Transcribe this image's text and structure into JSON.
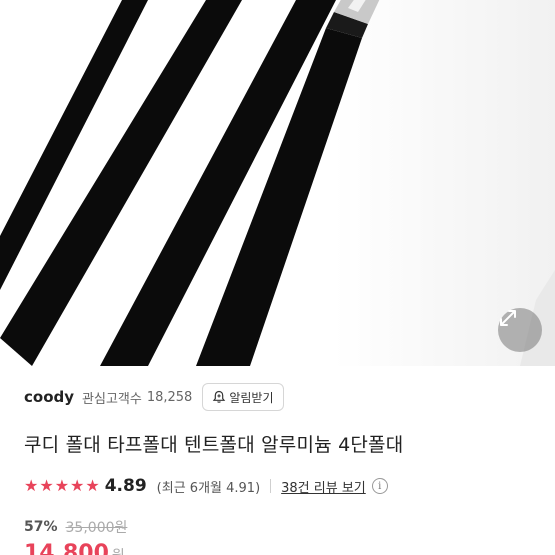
{
  "hero": {
    "image": "tent-pole-product-photo",
    "zoom_icon": "expand-arrows-icon"
  },
  "seller": {
    "name": "coody",
    "follower_label": "관심고객수",
    "follower_count": "18,258",
    "alert_button": "알림받기",
    "alert_icon": "bell-plus-icon"
  },
  "product": {
    "title": "쿠디 폴대 타프폴대 텐트폴대 알루미늄 4단폴대"
  },
  "rating": {
    "stars": 5,
    "value": "4.89",
    "recent": "(최근 6개월 4.91)",
    "review_link": "38건 리뷰 보기",
    "info_icon": "info-icon"
  },
  "price": {
    "discount_rate": "57%",
    "original_price": "35,000원",
    "sale_price": "14,800",
    "sale_unit": "원"
  },
  "colors": {
    "accent": "#e8435a"
  }
}
